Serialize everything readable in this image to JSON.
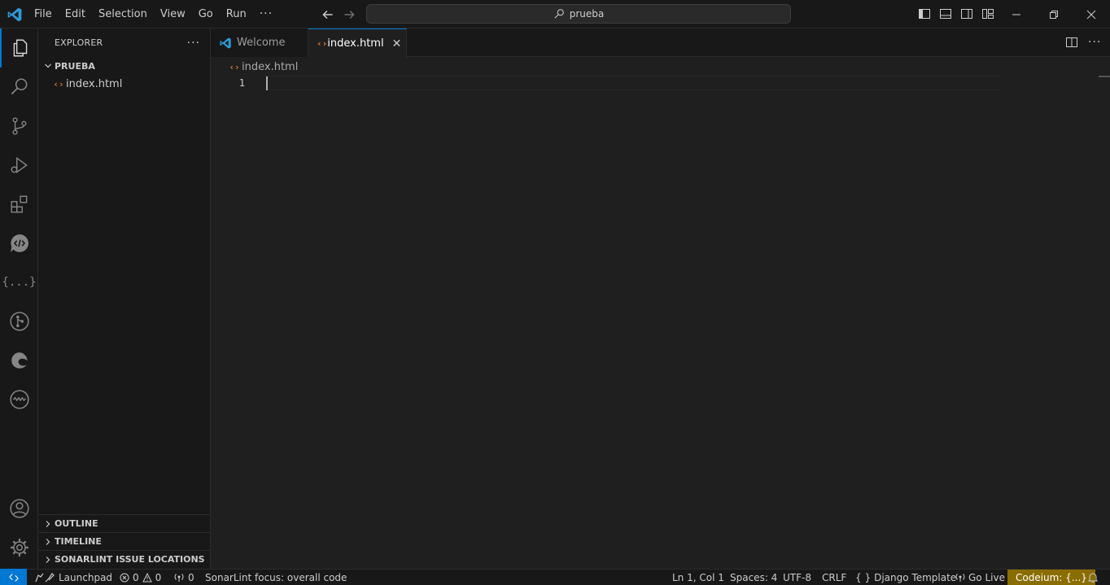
{
  "titlebar": {
    "menu": [
      "File",
      "Edit",
      "Selection",
      "View",
      "Go",
      "Run"
    ],
    "more": "···",
    "search_text": "prueba"
  },
  "activity": {
    "icons": [
      "explorer-icon",
      "search-icon",
      "source-control-icon",
      "run-debug-icon",
      "extensions-icon",
      "live-share-icon",
      "json-icon",
      "gitlens-icon",
      "edge-devtools-icon",
      "waveform-icon",
      "account-icon",
      "manage-gear-icon"
    ],
    "braces": "{...}"
  },
  "sidebar": {
    "title": "EXPLORER",
    "more": "···",
    "folder": "PRUEBA",
    "files": [
      "index.html"
    ],
    "sections": [
      "OUTLINE",
      "TIMELINE",
      "SONARLINT ISSUE LOCATIONS"
    ]
  },
  "editor": {
    "tabs": [
      {
        "label": "Welcome",
        "active": false
      },
      {
        "label": "index.html",
        "active": true,
        "close": "✕"
      }
    ],
    "breadcrumb": "index.html",
    "line_number": "1",
    "more": "···"
  },
  "statusbar": {
    "launchpad": "Launchpad",
    "errors": "0",
    "warnings": "0",
    "ports": "0",
    "sonarlint": "SonarLint focus: overall code",
    "position": "Ln 1, Col 1",
    "spaces": "Spaces: 4",
    "encoding": "UTF-8",
    "eol": "CRLF",
    "braces": "{ }",
    "language": "Django Template",
    "golive": "Go Live",
    "codeium": "Codeium: {...}"
  },
  "colors": {
    "accent": "#0078d4",
    "html_icon": "#e37933",
    "codeium_bg": "#8a6d00"
  }
}
